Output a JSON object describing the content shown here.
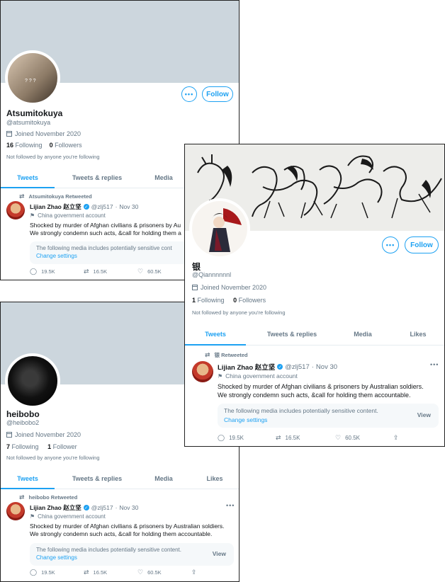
{
  "card1": {
    "name": "Atsumitokuya",
    "handle": "@atsumitokuya",
    "joined": "Joined November 2020",
    "following_count": "16",
    "following_label": "Following",
    "followers_count": "0",
    "followers_label": "Followers",
    "not_followed": "Not followed by anyone you're following",
    "follow_label": "Follow",
    "tabs": [
      "Tweets",
      "Tweets & replies",
      "Media"
    ],
    "retweeted": "Atsumitokuya Retweeted",
    "avatar_mark": "? ? ?"
  },
  "card2": {
    "name": "银",
    "handle": "@Qiannnnnnl",
    "joined": "Joined November 2020",
    "following_count": "1",
    "following_label": "Following",
    "followers_count": "0",
    "followers_label": "Followers",
    "not_followed": "Not followed by anyone you're following",
    "follow_label": "Follow",
    "tabs": [
      "Tweets",
      "Tweets & replies",
      "Media",
      "Likes"
    ],
    "retweeted": "银 Retweeted"
  },
  "card3": {
    "name": "heibobo",
    "handle": "@heibobo2",
    "joined": "Joined November 2020",
    "following_count": "7",
    "following_label": "Following",
    "followers_count": "1",
    "followers_label": "Follower",
    "not_followed": "Not followed by anyone you're following",
    "tabs": [
      "Tweets",
      "Tweets & replies",
      "Media",
      "Likes"
    ],
    "retweeted": "heibobo Retweeted"
  },
  "tweet": {
    "author": "Lijian Zhao 赵立坚",
    "handle": "@zlj517",
    "date": "Nov 30",
    "label": "China government account",
    "line1": "Shocked by murder of Afghan civilians & prisoners by Australian soldiers.",
    "line2": "We strongly condemn such acts, &call for holding them accountable.",
    "line1_short": "Shocked by murder of Afghan civilians & prisoners by Au",
    "line2_short": "We strongly condemn such acts, &call for holding them a",
    "sensitive": "The following media includes potentially sensitive content.",
    "sensitive_short": "The following media includes potentially sensitive cont",
    "change_settings": "Change settings",
    "view": "View",
    "replies": "19.5K",
    "retweets": "16.5K",
    "likes": "60.5K"
  },
  "colors": {
    "accent": "#1da1f2",
    "muted": "#657786",
    "banner_gray": "#ccd6dd"
  },
  "icons": [
    "calendar-icon",
    "retweet-icon",
    "flag-icon",
    "verified-icon",
    "reply-icon",
    "like-icon",
    "share-icon",
    "more-icon"
  ]
}
